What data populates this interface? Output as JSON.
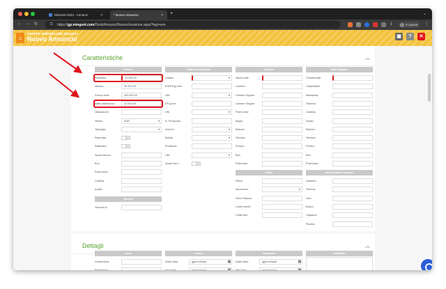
{
  "browser": {
    "tabs": [
      {
        "label": "MioGest 2024 - Annunci",
        "active": false
      },
      {
        "label": "* Nuovo Annuncio",
        "active": true
      }
    ],
    "url_prefix": "https://",
    "url_host": "gp.miogest.com",
    "url_path": "/Desk/Annunci/Nuovo/cessione.aspx?tag=ann",
    "profile_label": "In pausa"
  },
  "app": {
    "subtitle": "GRUPPO IMMOBILIARE MIOGEST",
    "title": "Nuovo Annuncio",
    "accent": "#f3c23b",
    "green": "#5aa531",
    "highlight": "#e0141c"
  },
  "caratteristiche": {
    "title": "Caratteristiche",
    "prezzo": {
      "header": "Prezzo",
      "rows": [
        {
          "label": "Richiesto:",
          "value": "10.000,00",
          "type": "input",
          "required": true
        },
        {
          "label": "Minimo:",
          "value": "50.000,00",
          "type": "input"
        },
        {
          "label": "Prezzo mutt.",
          "value": "300.000,00",
          "type": "input"
        },
        {
          "label": "Affitto Mutt Anno:",
          "value": "12.000,00",
          "type": "input"
        },
        {
          "label": "Valutazione:",
          "value": "",
          "type": "input"
        },
        {
          "label": "Valuta:",
          "value": "EUR",
          "type": "select"
        },
        {
          "label": "Tipologia:",
          "value": "",
          "type": "select"
        },
        {
          "label": "Riservato:",
          "value": "NO",
          "type": "toggle"
        },
        {
          "label": "Rilasciato:",
          "value": "NO",
          "type": "toggle"
        },
        {
          "label": "Spese Annue:",
          "value": "",
          "type": "input"
        },
        {
          "label": "Box:",
          "value": "",
          "type": "input"
        },
        {
          "label": "Posto Auto:",
          "value": "",
          "type": "input"
        },
        {
          "label": "Cantina:",
          "value": "",
          "type": "input"
        },
        {
          "label": "Arredi:",
          "value": "",
          "type": "input"
        }
      ]
    },
    "storico": {
      "header": "Storico",
      "rows": [
        {
          "label": "Venduto A:",
          "value": "",
          "type": "input"
        }
      ]
    },
    "classe_energetica": {
      "header": "Classe Energetica",
      "rows": [
        {
          "label": "Classe:",
          "value": "",
          "type": "select",
          "required": true
        },
        {
          "label": "IPE/EP,gl,nren:",
          "value": "",
          "type": "input"
        },
        {
          "label": "UM:",
          "value": "",
          "type": "select"
        },
        {
          "label": "EP,gl,ren:",
          "value": "",
          "type": "input"
        },
        {
          "label": "UM:",
          "value": "",
          "type": "select"
        },
        {
          "label": "N. Protocollo:",
          "value": "",
          "type": "input"
        },
        {
          "label": "Inverno:",
          "value": "",
          "type": "select"
        },
        {
          "label": "Estate:",
          "value": "",
          "type": "select"
        },
        {
          "label": "Emissioni:",
          "value": "",
          "type": "input"
        },
        {
          "label": "UM:",
          "value": "",
          "type": "select"
        },
        {
          "label": "Quasi Zero:",
          "value": "NO",
          "type": "toggle"
        }
      ]
    },
    "numero": {
      "header": "Numero",
      "rows": [
        {
          "label": "Vani/Locali:",
          "value": "",
          "type": "input",
          "required": true
        },
        {
          "label": "Camere:",
          "value": "",
          "type": "input"
        },
        {
          "label": "Camere Doppie:",
          "value": "",
          "type": "input"
        },
        {
          "label": "Camere Singole:",
          "value": "",
          "type": "input"
        },
        {
          "label": "Posti Letto:",
          "value": "",
          "type": "input"
        },
        {
          "label": "Bagni:",
          "value": "",
          "type": "input"
        },
        {
          "label": "Balconi:",
          "value": "",
          "type": "input"
        },
        {
          "label": "Terrazzi:",
          "value": "",
          "type": "input"
        },
        {
          "label": "Portico:",
          "value": "",
          "type": "input"
        },
        {
          "label": "Box:",
          "value": "",
          "type": "input"
        },
        {
          "label": "Posti Auto:",
          "value": "",
          "type": "input"
        }
      ]
    },
    "piano": {
      "header": "Piano",
      "rows": [
        {
          "label": "Piano:",
          "value": "",
          "type": "input"
        },
        {
          "label": "Ascensore:",
          "value": "",
          "type": "select"
        },
        {
          "label": "Piani Palazzo:",
          "value": "",
          "type": "input"
        },
        {
          "label": "Livelli Interni:",
          "value": "",
          "type": "input"
        },
        {
          "label": "Unità Imm.:",
          "value": "",
          "type": "input"
        }
      ]
    },
    "metri_quadri": {
      "header": "Metri Quadri",
      "rows": [
        {
          "label": "Commerciali:",
          "value": "",
          "type": "input",
          "required": true
        },
        {
          "label": "Calpestabili:",
          "value": "",
          "type": "input"
        },
        {
          "label": "Mansarda:",
          "value": "",
          "type": "input"
        },
        {
          "label": "Taverna:",
          "value": "",
          "type": "input"
        },
        {
          "label": "Cantina:",
          "value": "",
          "type": "input"
        },
        {
          "label": "Solaio:",
          "value": "",
          "type": "input"
        },
        {
          "label": "Balconi:",
          "value": "",
          "type": "input"
        },
        {
          "label": "Terrazzi:",
          "value": "",
          "type": "input"
        },
        {
          "label": "Portico:",
          "value": "",
          "type": "input"
        },
        {
          "label": "Box:",
          "value": "",
          "type": "input"
        },
        {
          "label": "Posti Auto:",
          "value": "",
          "type": "input"
        }
      ]
    },
    "mq_giardino": {
      "header": "Metri Quadri Giardino",
      "rows": [
        {
          "label": "Giardino:",
          "value": "",
          "type": "input"
        },
        {
          "label": "Terreno:",
          "value": "",
          "type": "input"
        },
        {
          "label": "Orto:",
          "value": "",
          "type": "input"
        },
        {
          "label": "Bosco:",
          "value": "",
          "type": "input"
        },
        {
          "label": "Capanno:",
          "value": "",
          "type": "input"
        },
        {
          "label": "Piscina:",
          "value": "",
          "type": "input"
        }
      ]
    }
  },
  "dettagli": {
    "title": "Dettagli",
    "anno": {
      "header": "Anno",
      "rows": [
        {
          "label": "Costruzione:",
          "value": "",
          "type": "input"
        },
        {
          "label": "Ristrutturaz.:",
          "value": "",
          "type": "input"
        }
      ]
    },
    "libero": {
      "header": "Libero",
      "rows": [
        {
          "label": "Dalla Data:",
          "value": "gg/mm/aaaa",
          "type": "date"
        },
        {
          "label": "Alla Data:",
          "value": "gg/mm/aaaa",
          "type": "date"
        }
      ]
    },
    "occupato": {
      "header": "Occupato",
      "rows": [
        {
          "label": "Dalla Data:",
          "value": "gg/mm/aaaa",
          "type": "date"
        },
        {
          "label": "Alla Data:",
          "value": "gg/mm/aaaa",
          "type": "date"
        }
      ]
    },
    "dettaglio": {
      "header": "Dettaglio"
    }
  }
}
